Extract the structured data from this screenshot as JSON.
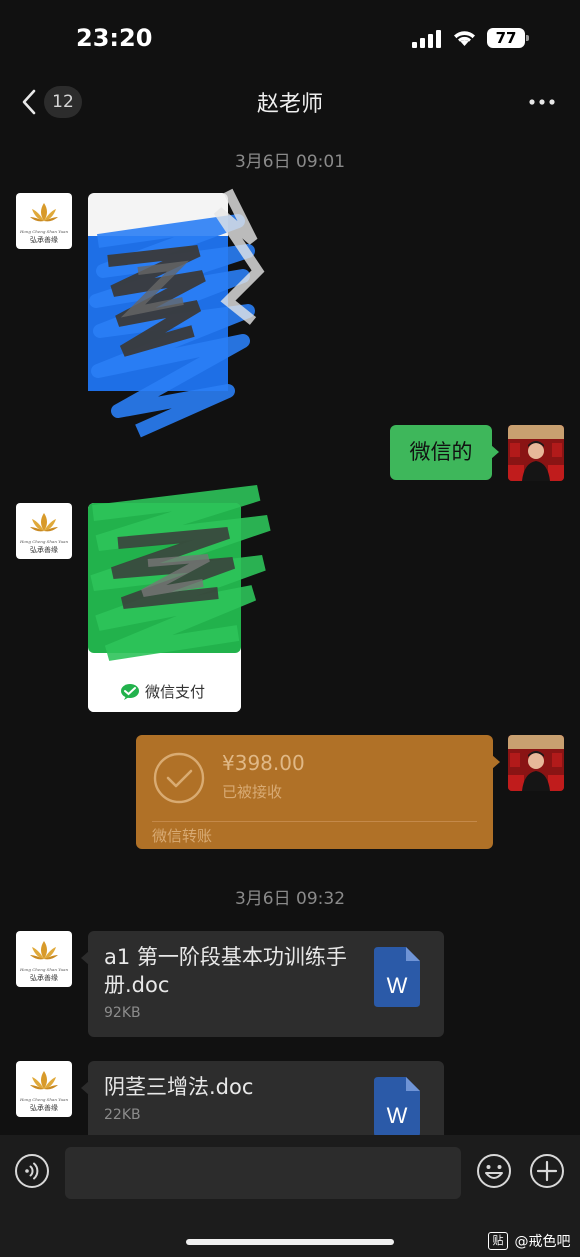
{
  "status_bar": {
    "time": "23:20",
    "battery": "77"
  },
  "nav": {
    "unread_count": "12",
    "title": "赵老师"
  },
  "messages": {
    "timestamp_1": "3月6日 09:01",
    "text_out": "微信的",
    "pay_card_label": "微信支付",
    "transfer": {
      "amount": "¥398.00",
      "status": "已被接收",
      "label": "微信转账"
    },
    "timestamp_2": "3月6日 09:32",
    "files": [
      {
        "name": "a1 第一阶段基本功训练手册.doc",
        "size": "92KB",
        "icon_letter": "W"
      },
      {
        "name": "阴茎三增法.doc",
        "size": "22KB",
        "icon_letter": "W"
      }
    ]
  },
  "avatar_logo": {
    "en_text": "Hong Cheng Shan Yuan",
    "cn_text": "弘承善缘"
  },
  "input_bar": {
    "placeholder": ""
  },
  "watermark": {
    "badge": "贴",
    "text": "@戒色吧"
  },
  "colors": {
    "background": "#111111",
    "outgoing_bubble": "#3eb75b",
    "transfer_card": "#b07127",
    "file_card": "#2d2d2d",
    "word_blue": "#2b5aa8"
  }
}
